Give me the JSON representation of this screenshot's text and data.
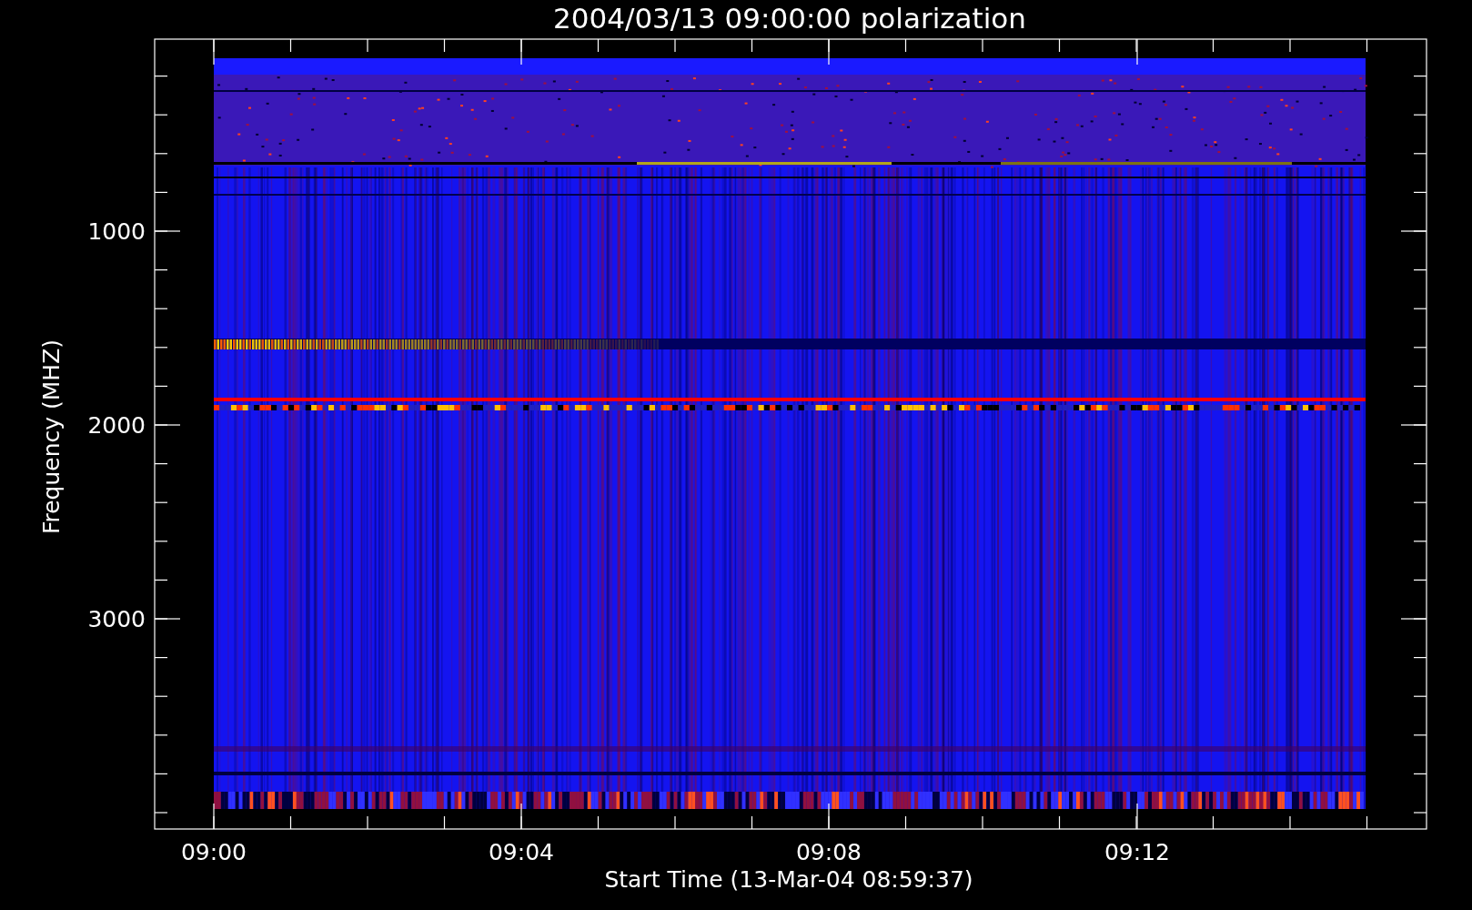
{
  "title": "2004/03/13 09:00:00 polarization",
  "y_axis": {
    "label": "Frequency (MHZ)",
    "tick_labels": [
      "1000",
      "2000",
      "3000"
    ]
  },
  "x_axis": {
    "label": "Start Time (13-Mar-04 08:59:37)",
    "tick_labels": [
      "09:00",
      "09:04",
      "09:08",
      "09:12"
    ]
  }
}
